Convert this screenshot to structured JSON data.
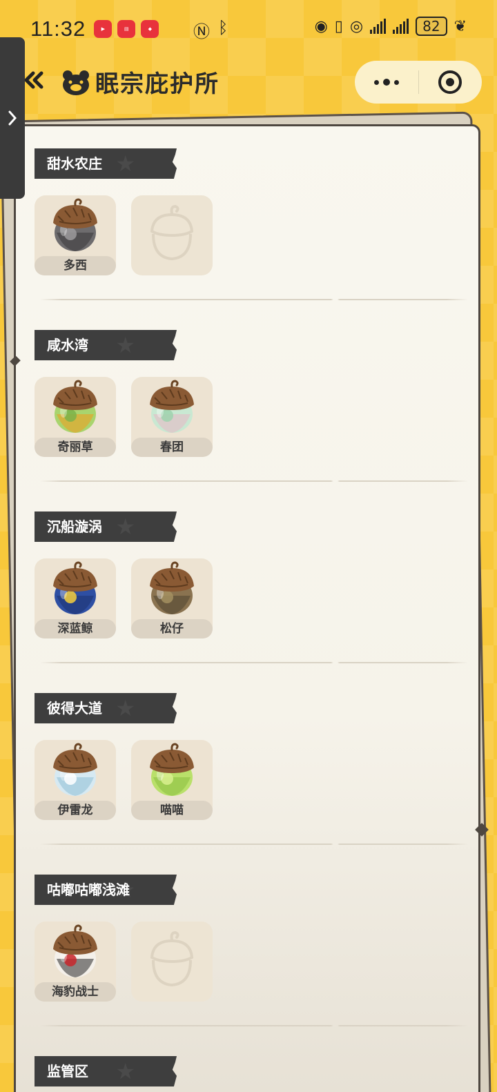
{
  "status_bar": {
    "time": "11:32",
    "battery": "82",
    "app_icons": [
      "huawei-video-icon",
      "book-icon",
      "xiaohongshu-icon"
    ]
  },
  "nav": {
    "title": "眠宗庇护所"
  },
  "sections": [
    {
      "title": "甜水农庄",
      "items": [
        {
          "name": "多西",
          "color": "dark-gray"
        },
        {
          "name": "",
          "empty": true
        }
      ]
    },
    {
      "title": "咸水湾",
      "items": [
        {
          "name": "奇丽草",
          "color": "green-orange"
        },
        {
          "name": "春团",
          "color": "mint-pink"
        }
      ]
    },
    {
      "title": "沉船漩涡",
      "items": [
        {
          "name": "深蓝鲸",
          "color": "navy"
        },
        {
          "name": "松仔",
          "color": "camo-brown"
        }
      ]
    },
    {
      "title": "彼得大道",
      "items": [
        {
          "name": "伊雷龙",
          "color": "pale-blue"
        },
        {
          "name": "喵喵",
          "color": "lime"
        }
      ]
    },
    {
      "title": "咕嘟咕嘟浅滩",
      "items": [
        {
          "name": "海豹战士",
          "color": "red-black"
        },
        {
          "name": "",
          "empty": true
        }
      ]
    },
    {
      "title": "监管区",
      "items": []
    }
  ],
  "colors": {
    "background": "#F8C83B",
    "paper": "#F9F7EF",
    "label_bg": "#3E3E3E",
    "acorn_cap": "#8A5A34"
  }
}
